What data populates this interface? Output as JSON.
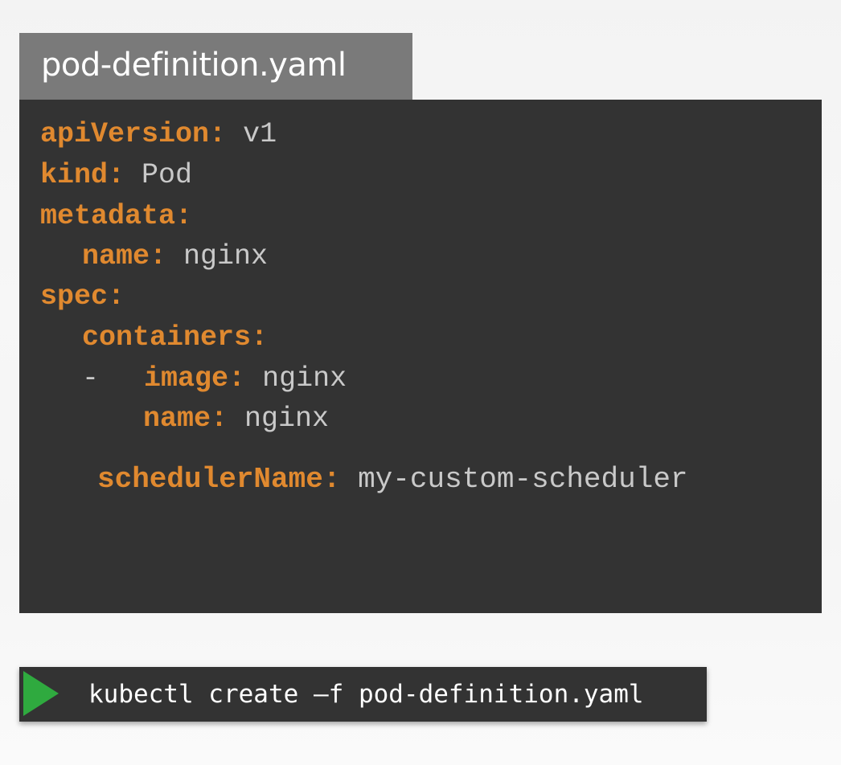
{
  "file_tab": {
    "title": "pod-definition.yaml"
  },
  "code": {
    "lines": [
      {
        "key": "apiVersion",
        "colon": ":",
        "value": " v1"
      },
      {
        "key": "kind",
        "colon": ":",
        "value": " Pod"
      },
      {
        "key": "metadata",
        "colon": ":",
        "value": ""
      },
      {
        "key": "name",
        "colon": ":",
        "value": " nginx"
      },
      {
        "key": "spec",
        "colon": ":",
        "value": ""
      },
      {
        "key": "containers",
        "colon": ":",
        "value": ""
      },
      {
        "dash": "-",
        "key": "image",
        "colon": ":",
        "value": " nginx"
      },
      {
        "key": "name",
        "colon": ":",
        "value": " nginx"
      },
      {
        "key": "schedulerName",
        "colon": ":",
        "value": " my-custom-scheduler"
      }
    ]
  },
  "command": {
    "text": "kubectl create –f pod-definition.yaml",
    "icon": "play-icon",
    "icon_color": "#2faa3f"
  },
  "colors": {
    "key": "#e0892f",
    "value": "#c9c9c9",
    "panel": "#333333",
    "tab": "#7a7a7a"
  }
}
